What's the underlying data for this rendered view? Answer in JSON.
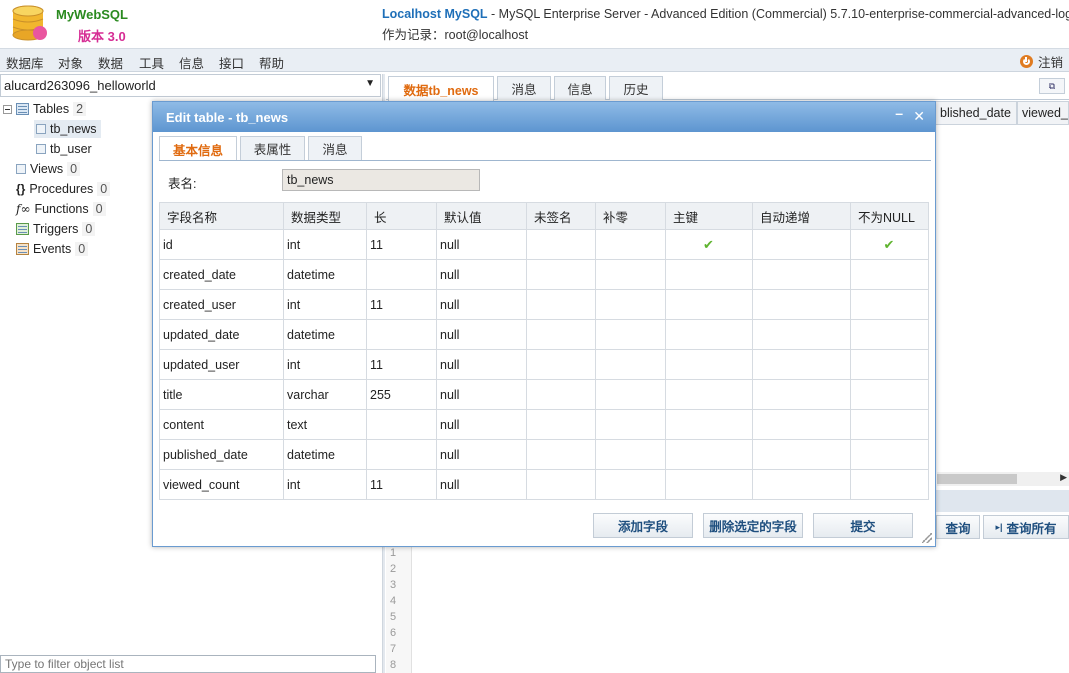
{
  "app": {
    "name": "MyWebSQL",
    "version": "版本 3.0",
    "server_name": "Localhost MySQL",
    "server_desc": " - MySQL Enterprise Server - Advanced Edition (Commercial) 5.7.10-enterprise-commercial-advanced-log",
    "login": "作为记录：root@localhost"
  },
  "menu": {
    "items": [
      "数据库",
      "对象",
      "数据",
      "工具",
      "信息",
      "接口",
      "帮助"
    ],
    "logout": "注销"
  },
  "sidebar": {
    "database": "alucard263096_helloworld",
    "tree": {
      "tables": {
        "label": "Tables",
        "count": "2"
      },
      "table_items": [
        "tb_news",
        "tb_user"
      ],
      "views": {
        "label": "Views",
        "count": "0"
      },
      "procedures": {
        "label": "Procedures",
        "count": "0"
      },
      "functions": {
        "label": "Functions",
        "count": "0"
      },
      "triggers": {
        "label": "Triggers",
        "count": "0"
      },
      "events": {
        "label": "Events",
        "count": "0"
      }
    },
    "filter_placeholder": "Type to filter object list"
  },
  "main": {
    "tabs": [
      "数据tb_news",
      "消息",
      "信息",
      "历史"
    ],
    "active_tab": 0,
    "grid_headers": [
      "blished_date",
      "viewed_"
    ],
    "query_buttons": [
      "查询",
      "查询所有"
    ],
    "line_numbers": [
      "1",
      "2",
      "3",
      "4",
      "5",
      "6",
      "7",
      "8"
    ]
  },
  "dialog": {
    "title": "Edit table - tb_news",
    "tabs": [
      "基本信息",
      "表属性",
      "消息"
    ],
    "active_tab": 0,
    "table_name_label": "表名:",
    "table_name_value": "tb_news",
    "columns": [
      "字段名称",
      "数据类型",
      "长",
      "默认值",
      "未签名",
      "补零",
      "主键",
      "自动递增",
      "不为NULL"
    ],
    "rows": [
      {
        "name": "id",
        "type": "int",
        "length": "11",
        "default": "null",
        "unsigned": false,
        "zerofill": false,
        "primary": true,
        "auto_inc": false,
        "not_null": true
      },
      {
        "name": "created_date",
        "type": "datetime",
        "length": "",
        "default": "null",
        "unsigned": false,
        "zerofill": false,
        "primary": false,
        "auto_inc": false,
        "not_null": false
      },
      {
        "name": "created_user",
        "type": "int",
        "length": "11",
        "default": "null",
        "unsigned": false,
        "zerofill": false,
        "primary": false,
        "auto_inc": false,
        "not_null": false
      },
      {
        "name": "updated_date",
        "type": "datetime",
        "length": "",
        "default": "null",
        "unsigned": false,
        "zerofill": false,
        "primary": false,
        "auto_inc": false,
        "not_null": false
      },
      {
        "name": "updated_user",
        "type": "int",
        "length": "11",
        "default": "null",
        "unsigned": false,
        "zerofill": false,
        "primary": false,
        "auto_inc": false,
        "not_null": false
      },
      {
        "name": "title",
        "type": "varchar",
        "length": "255",
        "default": "null",
        "unsigned": false,
        "zerofill": false,
        "primary": false,
        "auto_inc": false,
        "not_null": false
      },
      {
        "name": "content",
        "type": "text",
        "length": "",
        "default": "null",
        "unsigned": false,
        "zerofill": false,
        "primary": false,
        "auto_inc": false,
        "not_null": false
      },
      {
        "name": "published_date",
        "type": "datetime",
        "length": "",
        "default": "null",
        "unsigned": false,
        "zerofill": false,
        "primary": false,
        "auto_inc": false,
        "not_null": false
      },
      {
        "name": "viewed_count",
        "type": "int",
        "length": "11",
        "default": "null",
        "unsigned": false,
        "zerofill": false,
        "primary": false,
        "auto_inc": false,
        "not_null": false
      }
    ],
    "check_mark": "✔",
    "buttons": {
      "add": "添加字段",
      "delete": "删除选定的字段",
      "submit": "提交"
    }
  },
  "colors": {
    "accent": "#e06b10",
    "title_bar": "#5d95d0",
    "check": "#5fb42f",
    "server": "#1e6fb8"
  }
}
